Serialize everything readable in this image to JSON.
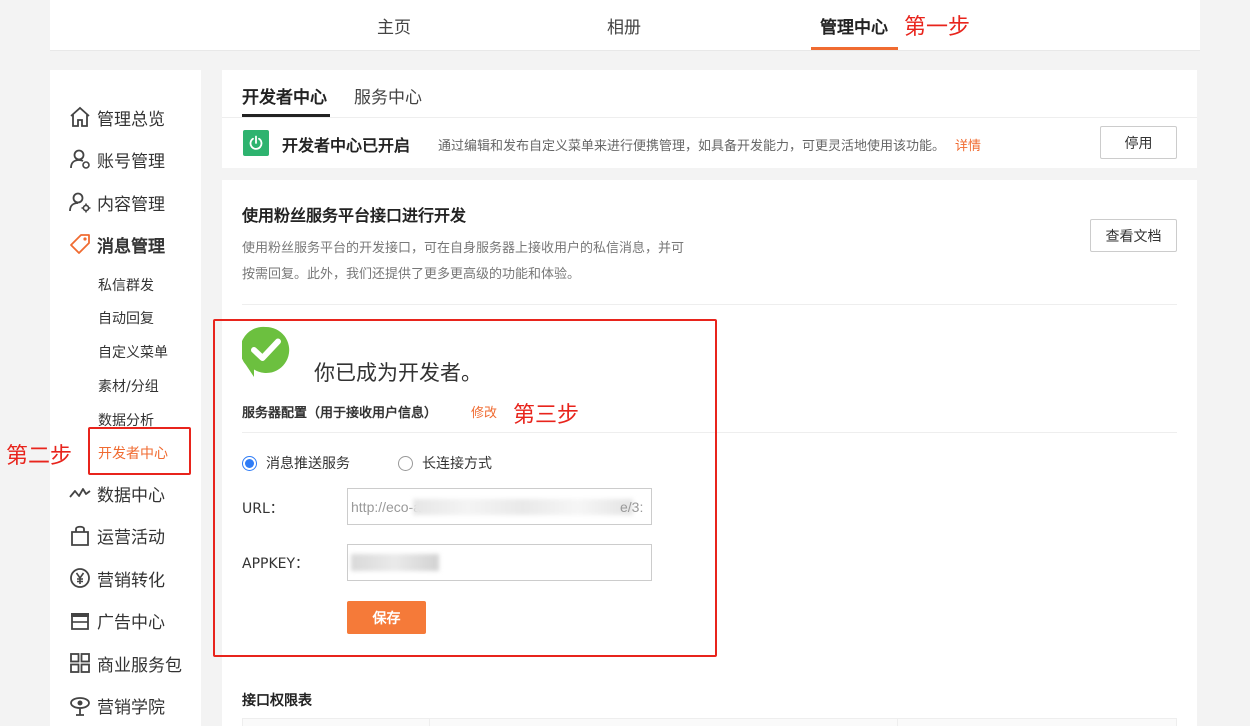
{
  "topnav": {
    "items": [
      "主页",
      "相册",
      "管理中心"
    ],
    "active": "管理中心"
  },
  "annotations": {
    "step1": "第一步",
    "step2": "第二步",
    "step3": "第三步"
  },
  "sidebar": {
    "items": [
      {
        "label": "管理总览",
        "icon": "home-icon"
      },
      {
        "label": "账号管理",
        "icon": "account-icon"
      },
      {
        "label": "内容管理",
        "icon": "content-icon"
      },
      {
        "label": "消息管理",
        "icon": "message-tag-icon"
      },
      {
        "label": "数据中心",
        "icon": "chart-line-icon"
      },
      {
        "label": "运营活动",
        "icon": "bag-icon"
      },
      {
        "label": "营销转化",
        "icon": "yen-icon"
      },
      {
        "label": "广告中心",
        "icon": "shop-icon"
      },
      {
        "label": "商业服务包",
        "icon": "grid-icon"
      },
      {
        "label": "营销学院",
        "icon": "academy-icon"
      }
    ],
    "submenu": [
      "私信群发",
      "自动回复",
      "自定义菜单",
      "素材/分组",
      "数据分析",
      "开发者中心"
    ],
    "current_submenu": "开发者中心"
  },
  "tabs": [
    "开发者中心",
    "服务中心"
  ],
  "status": {
    "title": "开发者中心已开启",
    "desc": "通过编辑和发布自定义菜单来进行便携管理，如具备开发能力，可更灵活地使用该功能。",
    "link": "详情",
    "disable_button": "停用"
  },
  "main": {
    "title": "使用粉丝服务平台接口进行开发",
    "desc_line1": "使用粉丝服务平台的开发接口，可在自身服务器上接收用户的私信消息，并可",
    "desc_line2": "按需回复。此外，我们还提供了更多更高级的功能和体验。",
    "docs_button": "查看文档",
    "developer_title": "你已成为开发者。",
    "server_label": "服务器配置（用于接收用户信息）",
    "modify": "修改",
    "radio_push": "消息推送服务",
    "radio_long": "长连接方式",
    "url_label": "URL：",
    "url_prefix": "http://eco-a",
    "url_suffix": "e/3:",
    "appkey_label": "APPKEY：",
    "save": "保存",
    "api_table_title": "接口权限表"
  },
  "colors": {
    "accent": "#f06b31",
    "annotation_red": "#e8241c",
    "status_green": "#2eb36f",
    "check_green": "#6cc03f"
  }
}
